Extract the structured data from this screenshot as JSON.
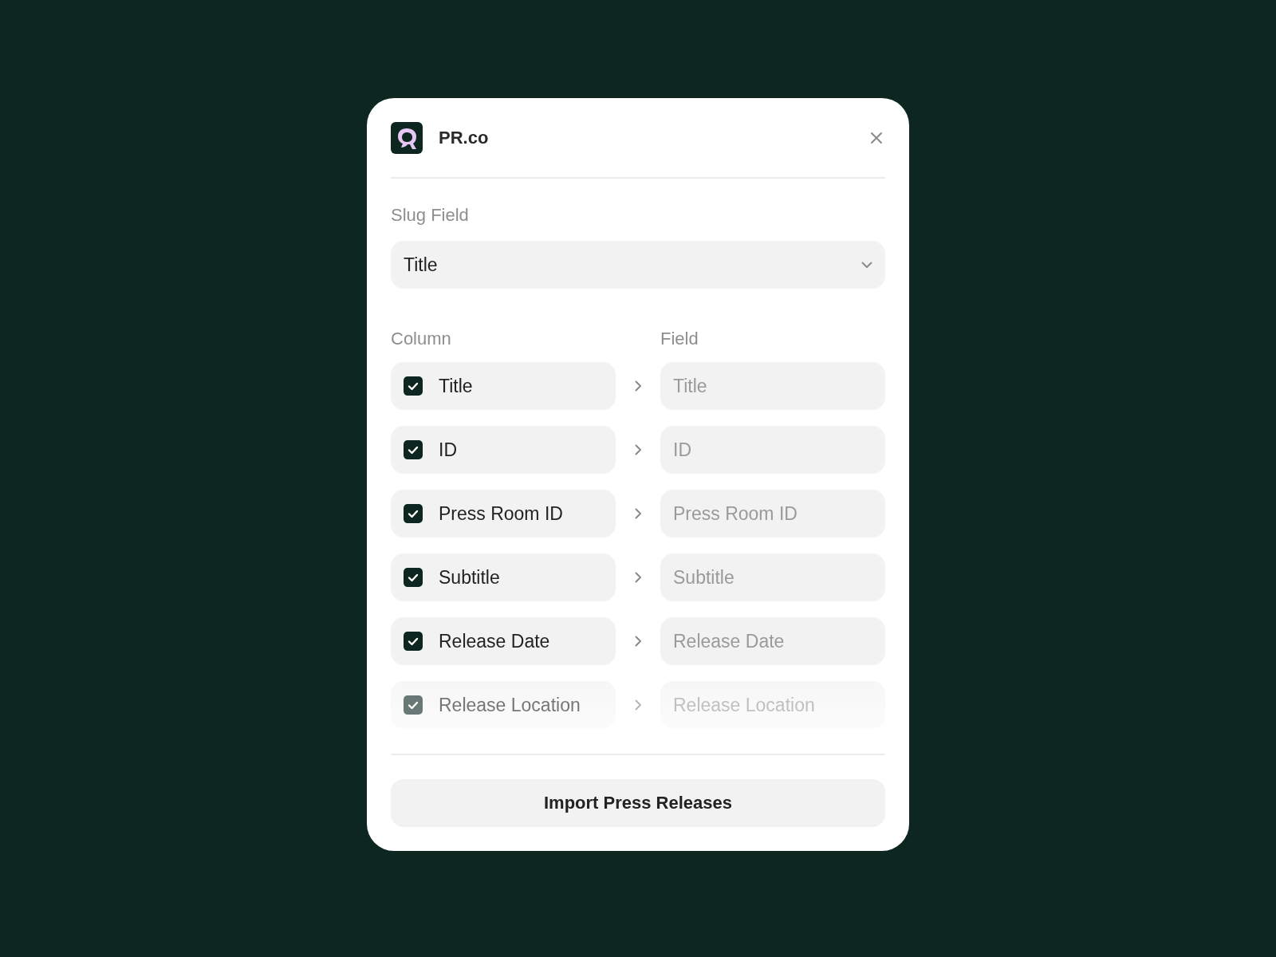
{
  "dialog": {
    "app_name": "PR.co"
  },
  "slug_field": {
    "label": "Slug Field",
    "value": "Title"
  },
  "mapping": {
    "column_heading": "Column",
    "field_heading": "Field",
    "rows": [
      {
        "column": "Title",
        "checked": true,
        "placeholder": "Title"
      },
      {
        "column": "ID",
        "checked": true,
        "placeholder": "ID"
      },
      {
        "column": "Press Room ID",
        "checked": true,
        "placeholder": "Press Room ID"
      },
      {
        "column": "Subtitle",
        "checked": true,
        "placeholder": "Subtitle"
      },
      {
        "column": "Release Date",
        "checked": true,
        "placeholder": "Release Date"
      },
      {
        "column": "Release Location",
        "checked": true,
        "placeholder": "Release Location"
      }
    ]
  },
  "button": "Import Press Releases"
}
